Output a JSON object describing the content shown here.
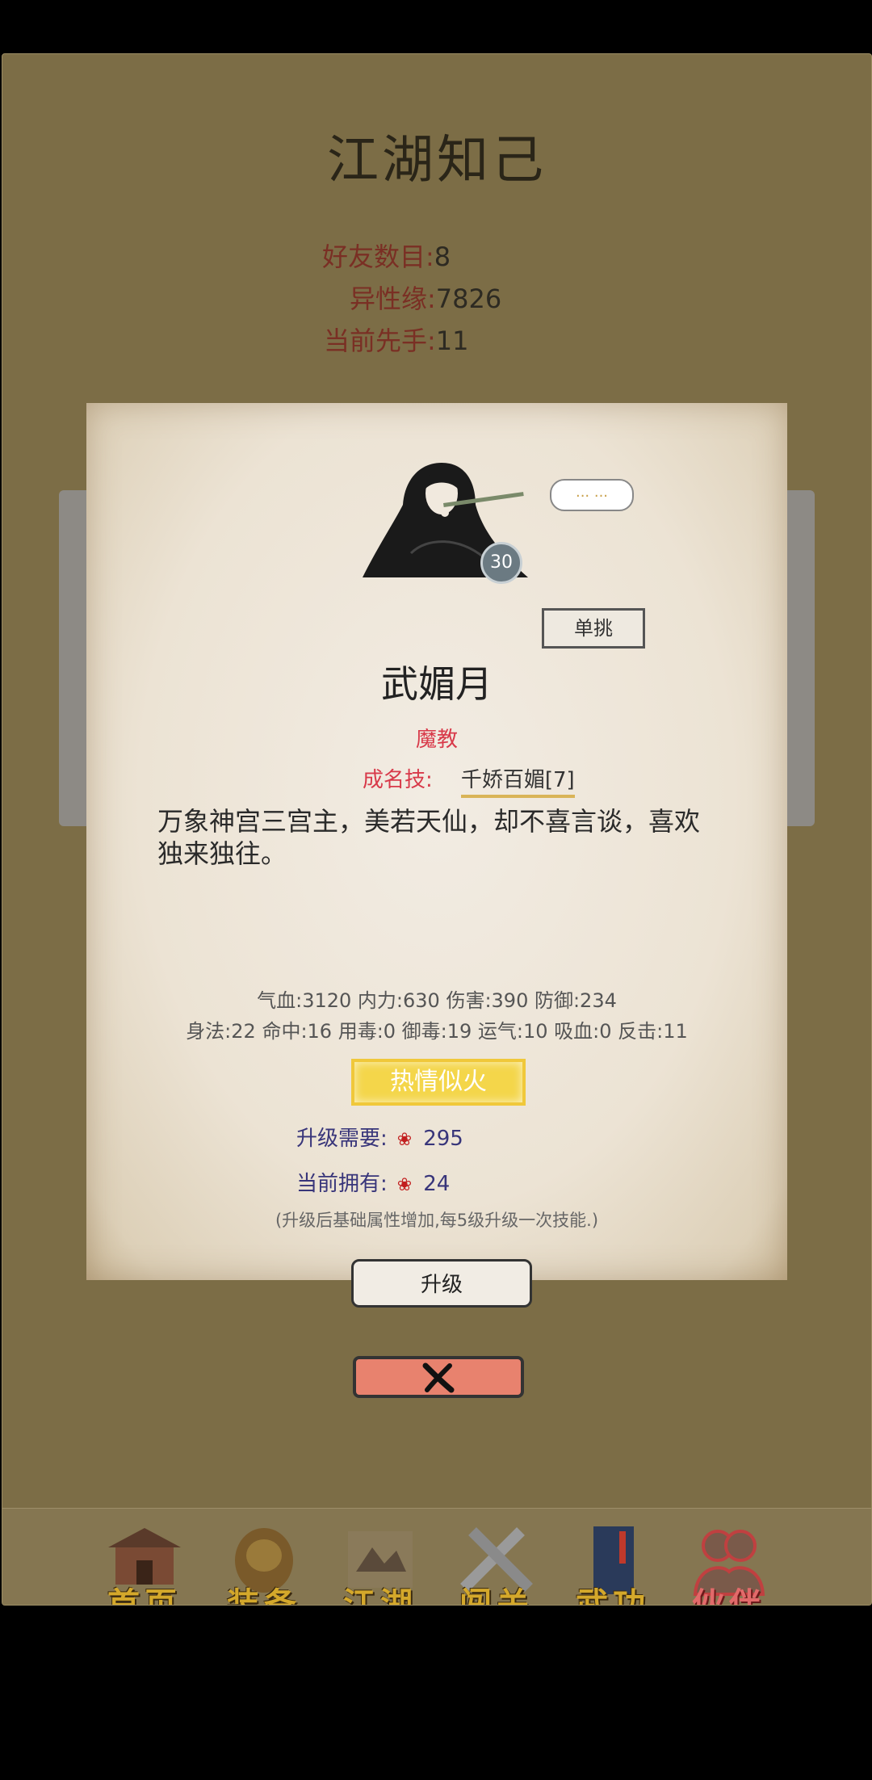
{
  "page": {
    "title": "江湖知己"
  },
  "stats": [
    {
      "key": "好友数目:",
      "value": "8"
    },
    {
      "key": "异性缘:",
      "value": "7826"
    },
    {
      "key": "当前先手:",
      "value": "11"
    }
  ],
  "card": {
    "level": "30",
    "speech": "... ...",
    "duel_label": "单挑",
    "name": "武媚月",
    "faction": "魔教",
    "skill_label": "成名技:",
    "skill_name": "千娇百媚[7]",
    "description": "万象神宫三宫主，美若天仙，却不喜言谈，喜欢独来独往。",
    "attrs_line1": "气血:3120  内力:630  伤害:390  防御:234",
    "attrs_line2": "身法:22  命中:16  用毒:0  御毒:19  运气:10  吸血:0  反击:11",
    "status_badge": "热情似火",
    "upgrade_need_label": "升级需要:",
    "upgrade_need_value": "295",
    "owned_label": "当前拥有:",
    "owned_value": "24",
    "note": "(升级后基础属性增加,每5级升级一次技能.)",
    "upgrade_button": "升级",
    "rose_icon": "rose-icon"
  },
  "colors": {
    "background": "#7c6d46",
    "label_red": "#7a2f24",
    "faction_red": "#d83a4a",
    "badge_yellow": "#f4d64a",
    "close_button": "#e8826e"
  },
  "nav": [
    {
      "label": "首页",
      "icon": "pavilion-icon"
    },
    {
      "label": "装备",
      "icon": "armor-icon"
    },
    {
      "label": "江湖",
      "icon": "map-scroll-icon"
    },
    {
      "label": "闯关",
      "icon": "crossed-swords-icon"
    },
    {
      "label": "武功",
      "icon": "martial-book-icon"
    },
    {
      "label": "伙伴",
      "icon": "partners-icon",
      "active": true
    }
  ]
}
